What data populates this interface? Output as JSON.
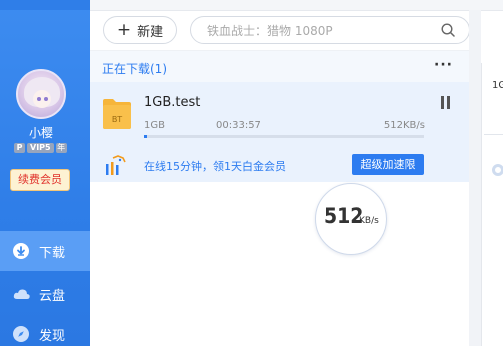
{
  "sidebar": {
    "username": "小樱",
    "badges": {
      "p": "P",
      "vip": "VIP5",
      "year": "年"
    },
    "renew_label": "续费会员",
    "nav": [
      {
        "label": "下载",
        "icon": "download-icon",
        "active": true
      },
      {
        "label": "云盘",
        "icon": "cloud-icon",
        "active": false
      },
      {
        "label": "发现",
        "icon": "compass-icon",
        "active": false
      }
    ]
  },
  "toolbar": {
    "new_label": "新建",
    "search_placeholder": "铁血战士：猎物 1080P"
  },
  "downloading": {
    "title": "正在下载(1)",
    "more": "···",
    "task": {
      "file_type": "BT",
      "name": "1GB.test",
      "size": "1GB",
      "elapsed": "00:33:57",
      "speed": "512KB/s",
      "progress_percent": 1
    },
    "promo": {
      "text": "在线15分钟，领1天白金会员",
      "button": "超级加速",
      "button_badge": "限"
    }
  },
  "speed_bubble": {
    "value": "512",
    "unit": "KB/s"
  },
  "right_panel": {
    "label": "1G"
  },
  "colors": {
    "sidebar": "#3d8cf0",
    "accent": "#2d7cf0",
    "renew_text": "#e0302a",
    "renew_bg": "#fdf2d3"
  }
}
